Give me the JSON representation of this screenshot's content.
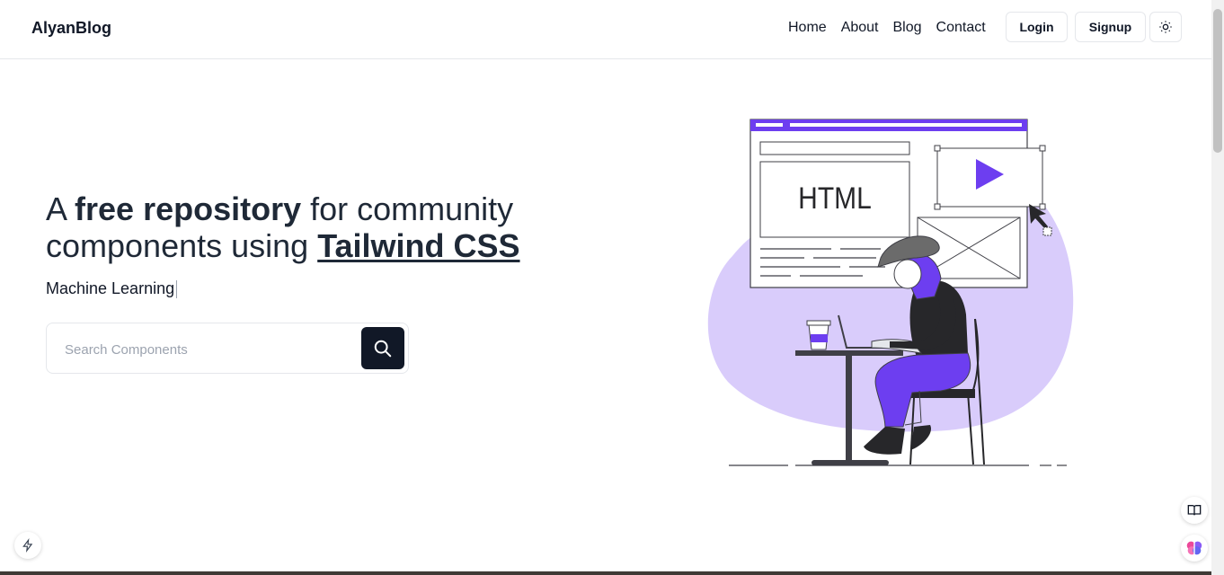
{
  "nav": {
    "brand": "AlyanBlog",
    "links": [
      "Home",
      "About",
      "Blog",
      "Contact"
    ],
    "login_label": "Login",
    "signup_label": "Signup",
    "theme_icon": "sun-icon"
  },
  "hero": {
    "title_part1": "A ",
    "title_bold": "free repository",
    "title_part2": " for community components using ",
    "title_link": "Tailwind CSS",
    "typed_text": "Machine Learning",
    "search_placeholder": "Search Components",
    "search_icon": "search-icon"
  },
  "illustration": {
    "html_label": "HTML"
  },
  "floating": {
    "book_icon": "book-icon",
    "brain_icon": "brain-icon",
    "bolt_icon": "bolt-icon"
  },
  "colors": {
    "accent": "#6d3ef0",
    "blob": "#d9ccfb",
    "dark": "#111827"
  }
}
